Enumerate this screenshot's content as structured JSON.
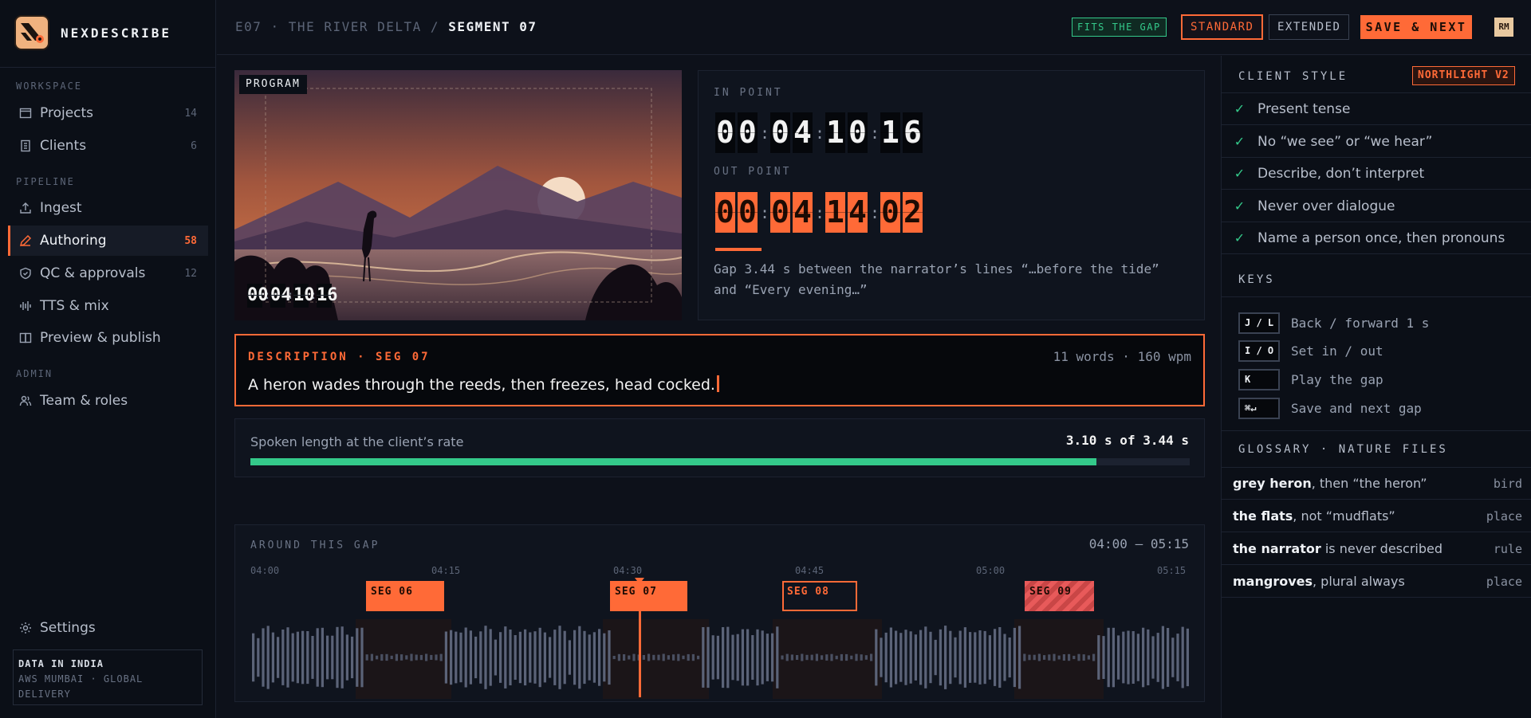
{
  "brand": {
    "name": "NEXDESCRIBE"
  },
  "sidebar": {
    "sections": [
      "WORKSPACE",
      "PIPELINE",
      "ADMIN"
    ],
    "items": [
      {
        "label": "Projects",
        "count": "14",
        "icon": "folder-icon"
      },
      {
        "label": "Clients",
        "count": "6",
        "icon": "building-icon"
      },
      {
        "label": "Ingest",
        "count": "",
        "icon": "upload-icon"
      },
      {
        "label": "Authoring",
        "count": "58",
        "icon": "pen-icon",
        "active": true
      },
      {
        "label": "QC & approvals",
        "count": "12",
        "icon": "shield-check-icon"
      },
      {
        "label": "TTS & mix",
        "count": "",
        "icon": "waveform-icon"
      },
      {
        "label": "Preview & publish",
        "count": "",
        "icon": "book-icon"
      },
      {
        "label": "Team & roles",
        "count": "",
        "icon": "users-icon"
      }
    ],
    "settings": "Settings",
    "region": {
      "line1": "DATA IN INDIA",
      "line2": "AWS MUMBAI · GLOBAL",
      "line3": "DELIVERY"
    }
  },
  "topbar": {
    "crumb_path": "E07 · THE RIVER DELTA /",
    "crumb_current": "SEGMENT 07",
    "fits_tag": "FITS THE GAP",
    "standard": "STANDARD",
    "extended": "EXTENDED",
    "save": "SAVE & NEXT",
    "avatar": "RM"
  },
  "program": {
    "label": "PROGRAM",
    "timecode": [
      "00",
      "04",
      "10",
      "16"
    ]
  },
  "points": {
    "in_label": "IN POINT",
    "in_tc": [
      "00",
      "04",
      "10",
      "16"
    ],
    "out_label": "OUT POINT",
    "out_tc": [
      "00",
      "04",
      "14",
      "02"
    ],
    "gap_text": "Gap 3.44 s between the narrator’s lines “…before the tide” and “Every evening…”"
  },
  "description": {
    "label": "DESCRIPTION · SEG 07",
    "meta": "11 words · 160 wpm",
    "text": "A heron wades through the reeds, then freezes, head cocked."
  },
  "spoken": {
    "label": "Spoken length at the client’s rate",
    "value_text": "3.10 s of 3.44 s",
    "fraction": 0.901
  },
  "timeline": {
    "label": "AROUND THIS GAP",
    "range": "04:00 – 05:15",
    "ticks": [
      "04:00",
      "04:15",
      "04:30",
      "04:45",
      "05:00",
      "05:15"
    ],
    "segments": [
      {
        "label": "SEG 06",
        "style": "solid"
      },
      {
        "label": "SEG 07",
        "style": "solid"
      },
      {
        "label": "SEG 08",
        "style": "outline"
      },
      {
        "label": "SEG 09",
        "style": "hatched"
      }
    ]
  },
  "client_style": {
    "heading": "CLIENT STYLE",
    "badge": "NORTHLIGHT V2",
    "rules": [
      "Present tense",
      "No “we see” or “we hear”",
      "Describe, don’t interpret",
      "Never over dialogue",
      "Name a person once, then pronouns"
    ]
  },
  "keys": {
    "heading": "KEYS",
    "items": [
      {
        "key": "J / L",
        "desc": "Back / forward 1 s"
      },
      {
        "key": "I / O",
        "desc": "Set in / out"
      },
      {
        "key": "K",
        "desc": "Play the gap"
      },
      {
        "key": "⌘↵",
        "desc": "Save and next gap"
      }
    ]
  },
  "glossary": {
    "heading": "GLOSSARY · NATURE FILES",
    "items": [
      {
        "term": "grey heron",
        "note": ", then “the heron”",
        "cat": "bird"
      },
      {
        "term": "the flats",
        "note": ", not “mudflats”",
        "cat": "place"
      },
      {
        "term": "the narrator",
        "note": " is never described",
        "cat": "rule"
      },
      {
        "term": "mangroves",
        "note": ", plural always",
        "cat": "place"
      }
    ]
  },
  "colors": {
    "accent": "#ff6a37",
    "ok": "#34c98a",
    "bg": "#0d111a"
  }
}
